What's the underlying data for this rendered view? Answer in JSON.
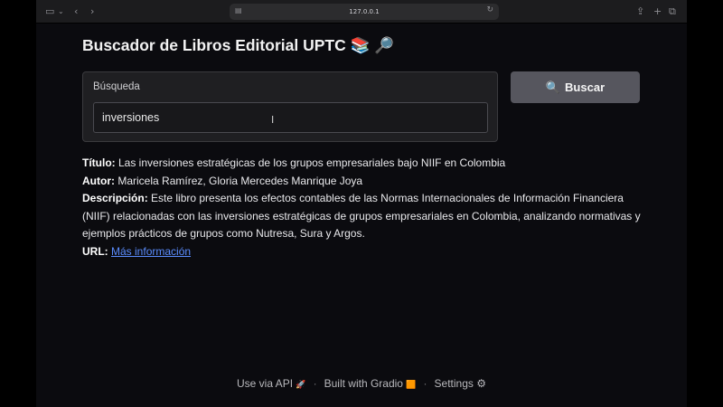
{
  "browser": {
    "url": "127.0.0.1"
  },
  "app": {
    "title": "Buscador de Libros Editorial UPTC",
    "title_emoji": "📚 🔎"
  },
  "search": {
    "label": "Búsqueda",
    "value": "inversiones",
    "button_icon": "🔍",
    "button_label": "Buscar"
  },
  "result": {
    "title_label": "Título:",
    "title_value": "Las inversiones estratégicas de los grupos empresariales bajo NIIF en Colombia",
    "author_label": "Autor:",
    "author_value": "Maricela Ramírez, Gloria Mercedes Manrique Joya",
    "description_label": "Descripción:",
    "description_value": "Este libro presenta los efectos contables de las Normas Internacionales de Información Financiera (NIIF) relacionadas con las inversiones estratégicas de grupos empresariales en Colombia, analizando normativas y ejemplos prácticos de grupos como Nutresa, Sura y Argos.",
    "url_label": "URL:",
    "url_link_text": "Más información"
  },
  "footer": {
    "api_label": "Use via API",
    "api_icon": "🚀",
    "built_label": "Built with Gradio",
    "built_icon": "🟧",
    "settings_label": "Settings",
    "settings_icon": "⚙"
  }
}
